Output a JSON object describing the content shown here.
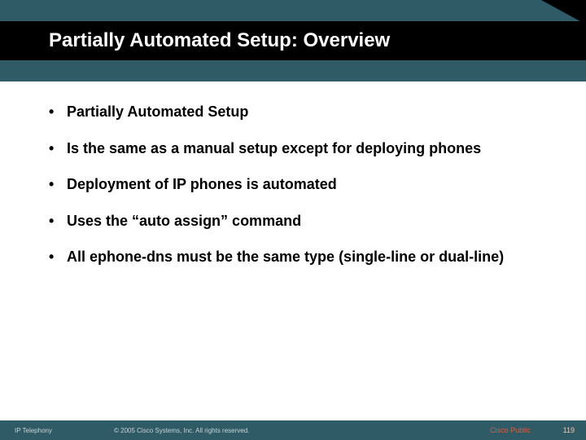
{
  "header": {
    "title": "Partially Automated Setup: Overview"
  },
  "bullets": {
    "b0": "Partially Automated Setup",
    "b1": "Is the same as a manual setup except for deploying phones",
    "b2": "Deployment of IP phones is automated",
    "b3": "Uses the “auto assign” command",
    "b4": "All ephone-dns must be the same type (single-line or dual-line)"
  },
  "footer": {
    "left": "IP Telephony",
    "copyright": "© 2005 Cisco Systems, Inc. All rights reserved.",
    "public": "Cisco Public",
    "page": "119"
  }
}
